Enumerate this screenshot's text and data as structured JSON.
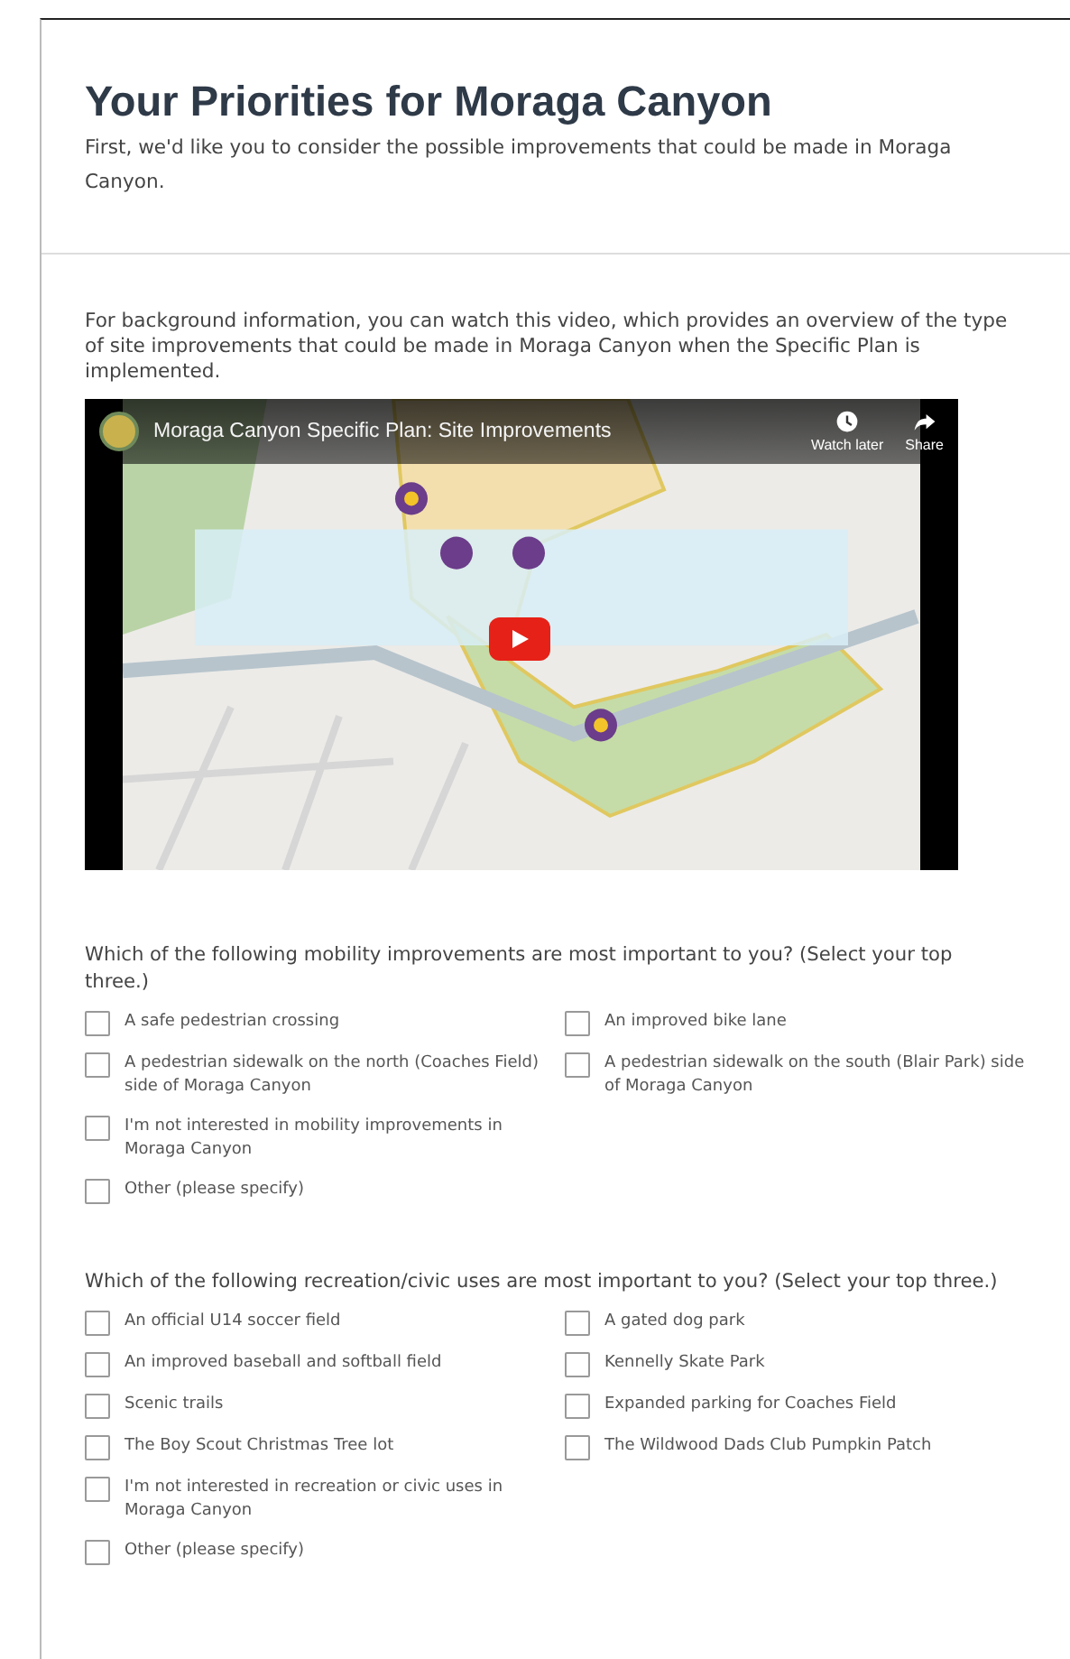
{
  "header": {
    "title": "Your Priorities for Moraga Canyon",
    "subtitle": "First, we'd like you to consider the possible improvements that could be made in Moraga Canyon."
  },
  "intro": "For background information, you can watch this video, which provides an overview of the type of site improvements that could be made in Moraga Canyon when the Specific Plan is implemented.",
  "video": {
    "kind": "picture",
    "title": "Moraga Canyon Specific Plan: Site Improvements",
    "watch_later": "Watch later",
    "share": "Share"
  },
  "questions": [
    {
      "prompt": "Which of the following mobility improvements are most important to you? (Select your top three.)",
      "columns": [
        [
          {
            "label": "A safe pedestrian crossing",
            "checked": false
          },
          {
            "label": "A pedestrian sidewalk on the north (Coaches Field) side of Moraga Canyon",
            "checked": false
          },
          {
            "label": "I'm not interested in mobility improvements in Moraga Canyon",
            "checked": false
          },
          {
            "label": "Other (please specify)",
            "checked": false
          }
        ],
        [
          {
            "label": "An improved bike lane",
            "checked": false
          },
          {
            "label": "A pedestrian sidewalk on the south (Blair Park) side of Moraga Canyon",
            "checked": false
          }
        ]
      ]
    },
    {
      "prompt": "Which of the following recreation/civic uses are most important to you? (Select your top three.)",
      "columns": [
        [
          {
            "label": "An official U14 soccer field",
            "checked": false
          },
          {
            "label": "An improved baseball and softball field",
            "checked": false
          },
          {
            "label": "Scenic trails",
            "checked": false
          },
          {
            "label": "The Boy Scout Christmas Tree lot",
            "checked": false
          },
          {
            "label": "I'm not interested in recreation or civic uses in Moraga Canyon",
            "checked": false
          },
          {
            "label": "Other (please specify)",
            "checked": false
          }
        ],
        [
          {
            "label": "A gated dog park",
            "checked": false
          },
          {
            "label": "Kennelly Skate Park",
            "checked": false
          },
          {
            "label": "Expanded parking for Coaches Field",
            "checked": false
          },
          {
            "label": "The Wildwood Dads Club Pumpkin Patch",
            "checked": false
          }
        ]
      ]
    }
  ]
}
